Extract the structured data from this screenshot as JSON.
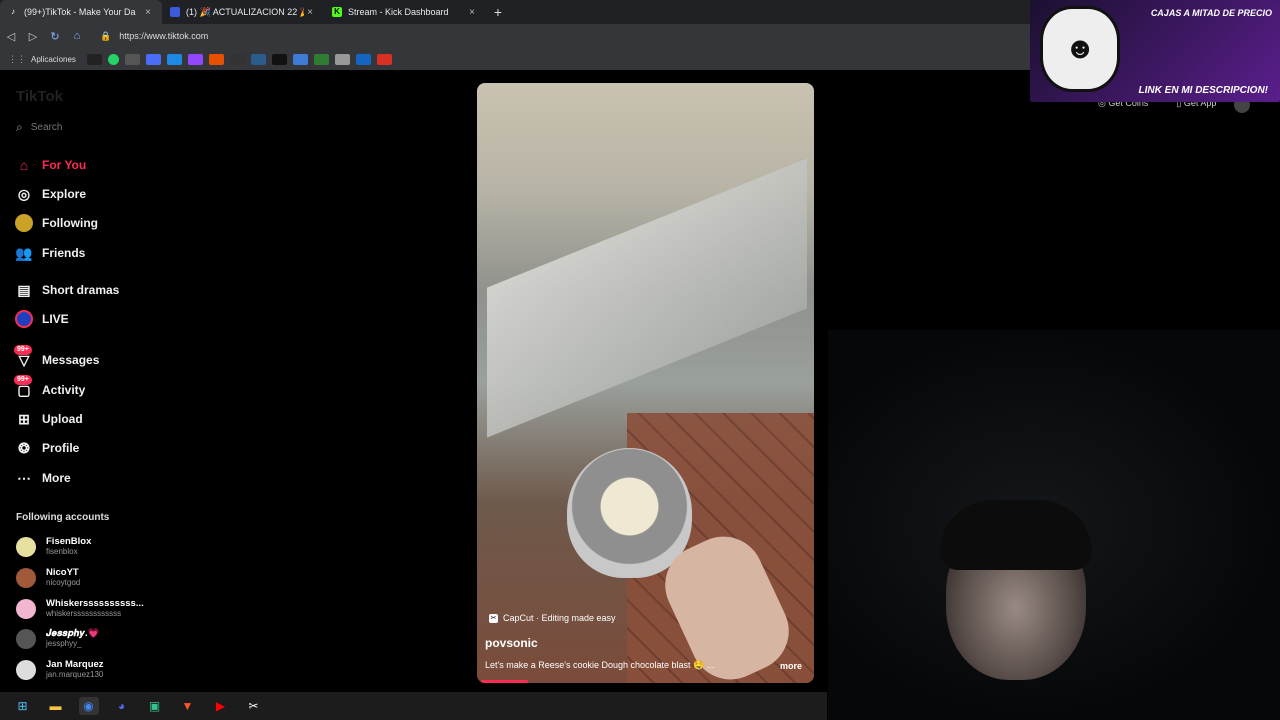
{
  "browser": {
    "tabs": [
      {
        "title": "(99+)TikTok - Make Your Da",
        "icon": "tiktok-icon",
        "active": true
      },
      {
        "title": "(1) 🎉 ACTUALIZACION 22 🎉 -",
        "icon": "roblox-icon",
        "active": false
      },
      {
        "title": "Stream - Kick Dashboard",
        "icon": "kick-icon",
        "active": false
      }
    ],
    "new_tab": "+",
    "tab_close": "×",
    "url": "https://www.tiktok.com",
    "bookmarks_label": "Aplicaciones"
  },
  "sidebar": {
    "logo": "TikTok",
    "search_placeholder": "Search",
    "items": [
      {
        "label": "For You",
        "icon": "home-icon"
      },
      {
        "label": "Explore",
        "icon": "compass-icon"
      },
      {
        "label": "Following",
        "icon": "following-icon"
      },
      {
        "label": "Friends",
        "icon": "friends-icon"
      },
      {
        "label": "Short dramas",
        "icon": "film-icon"
      },
      {
        "label": "LIVE",
        "icon": "live-icon"
      },
      {
        "label": "Messages",
        "icon": "messages-icon",
        "badge": "99+"
      },
      {
        "label": "Activity",
        "icon": "activity-icon",
        "badge": "99+"
      },
      {
        "label": "Upload",
        "icon": "upload-icon"
      },
      {
        "label": "Profile",
        "icon": "profile-icon"
      },
      {
        "label": "More",
        "icon": "more-icon"
      }
    ],
    "following_title": "Following accounts",
    "accounts": [
      {
        "name": "FisenBlox",
        "handle": "fisenblox"
      },
      {
        "name": "NicoYT",
        "handle": "nicoytgod"
      },
      {
        "name": "Whiskerssssssssss...",
        "handle": "whiskerssssssssssss"
      },
      {
        "name": "𝑱𝒆𝒔𝒔𝒑𝒉𝒚.💗",
        "handle": "jessphyy_"
      },
      {
        "name": "Jan Marquez",
        "handle": "jan.marquez130"
      }
    ]
  },
  "video": {
    "capcut": "CapCut · Editing made easy",
    "author": "povsonic",
    "caption": "Let's make a Reese's cookie Dough chocolate blast 🤤 ...",
    "more": "more",
    "progress": 0.14
  },
  "header": {
    "get_coins": "Get Coins",
    "get_app": "Get App"
  },
  "overlay": {
    "top_text": "CAJAS A MITAD DE PRECIO",
    "bottom_text": "LINK EN MI DESCRIPCION!"
  }
}
